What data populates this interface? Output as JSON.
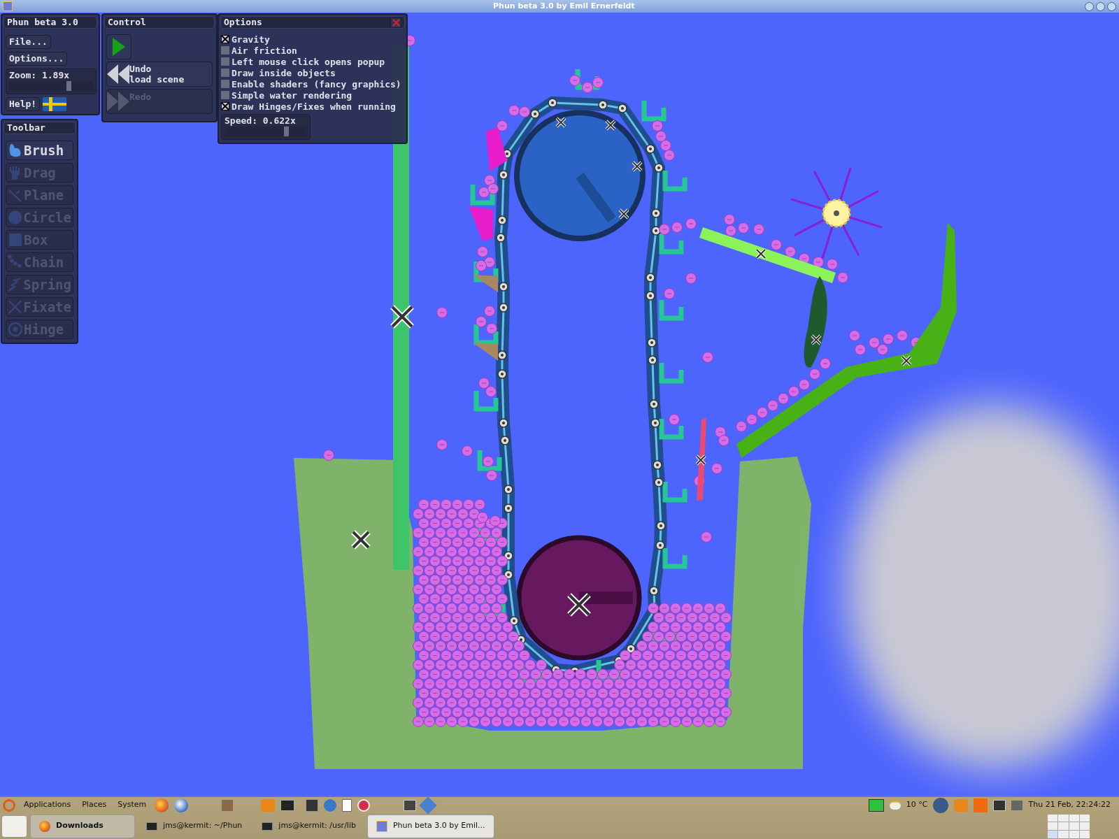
{
  "window": {
    "title": "Phun beta 3.0 by Emil Ernerfeldt"
  },
  "main_panel": {
    "title": "Phun beta 3.0",
    "buttons": [
      "File...",
      "Options..."
    ],
    "zoom": {
      "label": "Zoom: 1.89x",
      "level": 0.74
    },
    "help": "Help!"
  },
  "control_panel": {
    "title": "Control",
    "undo": [
      "Undo",
      "load scene"
    ],
    "redo": {
      "label": "Redo",
      "disabled": true
    }
  },
  "options_panel": {
    "title": "Options",
    "options": [
      {
        "label": "Gravity",
        "checked": true
      },
      {
        "label": "Air friction",
        "checked": false
      },
      {
        "label": "Left mouse click opens popup",
        "checked": false
      },
      {
        "label": "Draw inside objects",
        "checked": false
      },
      {
        "label": "Enable shaders (fancy graphics)",
        "checked": false
      },
      {
        "label": "Simple water rendering",
        "checked": false
      },
      {
        "label": "Draw Hinges/Fixes when running",
        "checked": true
      }
    ],
    "speed": {
      "label": "Speed: 0.622x",
      "level": 0.78
    }
  },
  "toolbar": {
    "title": "Toolbar",
    "tools": [
      {
        "label": "Brush",
        "selected": true
      },
      {
        "label": "Drag",
        "selected": false
      },
      {
        "label": "Plane",
        "selected": false
      },
      {
        "label": "Circle",
        "selected": false
      },
      {
        "label": "Box",
        "selected": false
      },
      {
        "label": "Chain",
        "selected": false
      },
      {
        "label": "Spring",
        "selected": false
      },
      {
        "label": "Fixate",
        "selected": false
      },
      {
        "label": "Hinge",
        "selected": false
      }
    ]
  },
  "taskbar": {
    "menus": [
      "Applications",
      "Places",
      "System"
    ],
    "tasks": [
      {
        "label": "Downloads",
        "kind": "browser",
        "highlighted": true,
        "selected": false
      },
      {
        "label": "jms@kermit: ~/Phun",
        "kind": "terminal",
        "highlighted": false,
        "selected": false
      },
      {
        "label": "jms@kermit: /usr/lib",
        "kind": "terminal",
        "highlighted": false,
        "selected": false
      },
      {
        "label": "Phun beta 3.0 by Emil...",
        "kind": "app",
        "highlighted": false,
        "selected": true
      }
    ],
    "temperature": "10 °C",
    "clock": "Thu 21 Feb, 22:24:22"
  }
}
